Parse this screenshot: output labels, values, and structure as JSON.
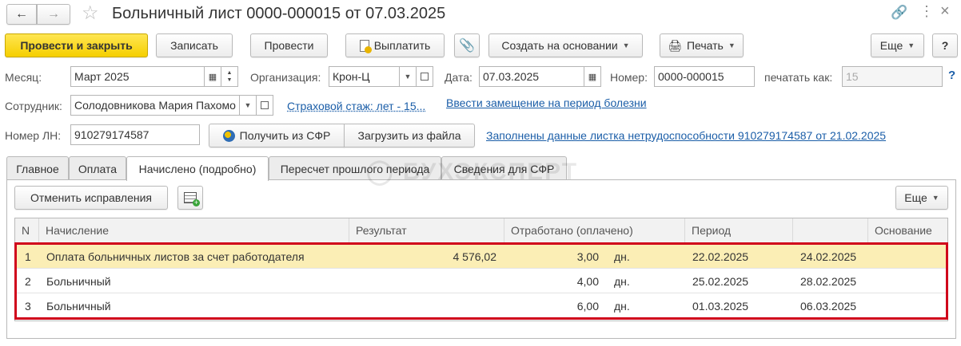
{
  "title": "Больничный лист 0000-000015 от 07.03.2025",
  "toolbar": {
    "post_close": "Провести и закрыть",
    "save": "Записать",
    "post": "Провести",
    "pay": "Выплатить",
    "create_based": "Создать на основании",
    "print": "Печать",
    "more": "Еще",
    "help": "?"
  },
  "form": {
    "month_label": "Месяц:",
    "month_value": "Март 2025",
    "org_label": "Организация:",
    "org_value": "Крон-Ц",
    "date_label": "Дата:",
    "date_value": "07.03.2025",
    "number_label": "Номер:",
    "number_value": "0000-000015",
    "print_as_label": "печатать как:",
    "print_as_value": "15",
    "help_q": "?",
    "employee_label": "Сотрудник:",
    "employee_value": "Солодовникова Мария Пахомо",
    "insurance_link": "Страховой стаж: лет - 15...",
    "replacement_link": "Ввести замещение на период болезни",
    "sick_number_label": "Номер ЛН:",
    "sick_number_value": "910279174587",
    "get_sfr": "Получить из СФР",
    "load_file": "Загрузить из файла",
    "filled_link": "Заполнены данные листка нетрудоспособности 910279174587 от 21.02.2025"
  },
  "tabs": [
    {
      "label": "Главное"
    },
    {
      "label": "Оплата"
    },
    {
      "label": "Начислено (подробно)"
    },
    {
      "label": "Пересчет прошлого периода"
    },
    {
      "label": "Сведения для СФР"
    }
  ],
  "watermark": "БУХЭКСПЕРТ",
  "panel": {
    "cancel_corrections": "Отменить исправления",
    "more": "Еще"
  },
  "table": {
    "headers": [
      "N",
      "Начисление",
      "Результат",
      "Отработано (оплачено)",
      "Период",
      "",
      "Основание"
    ],
    "rows": [
      {
        "n": "1",
        "accrual": "Оплата больничных листов за счет работодателя",
        "result": "4 576,02",
        "worked": "3,00",
        "unit": "дн.",
        "from": "22.02.2025",
        "to": "24.02.2025",
        "basis": ""
      },
      {
        "n": "2",
        "accrual": "Больничный",
        "result": "",
        "worked": "4,00",
        "unit": "дн.",
        "from": "25.02.2025",
        "to": "28.02.2025",
        "basis": ""
      },
      {
        "n": "3",
        "accrual": "Больничный",
        "result": "",
        "worked": "6,00",
        "unit": "дн.",
        "from": "01.03.2025",
        "to": "06.03.2025",
        "basis": ""
      }
    ]
  },
  "colors": {
    "primary_button": "#f5cf00",
    "link": "#1b5ea8",
    "selected_row": "#fbeeb5",
    "highlight": "#d0021b"
  }
}
